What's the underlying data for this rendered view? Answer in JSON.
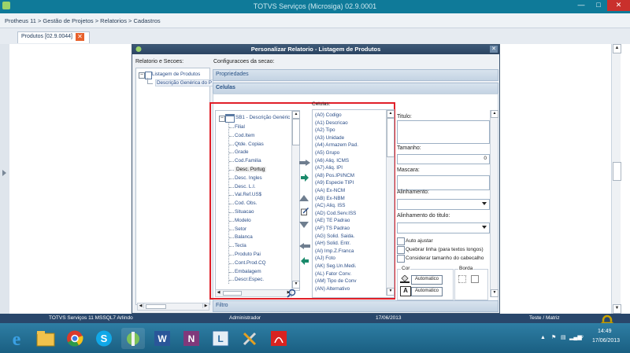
{
  "window": {
    "title": "TOTVS Serviços (Microsiga) 02.9.0001"
  },
  "breadcrumb": "Protheus 11 > Gestão de Projetos > Relatorios > Cadastros",
  "tab": {
    "label": "Produtos [02.9.0044]"
  },
  "dialog": {
    "title": "Personalizar Relatorio - Listagem de Produtos",
    "sections_label": "Relatorio e Secoes:",
    "config_label": "Configuracoes da secao:",
    "tree": {
      "root": "Listagem de Produtos",
      "child": "Descrição Genérica do P"
    },
    "propriedades": "Propriedades",
    "celulas": "Celulas",
    "celulas_sub": "Celulas:",
    "filtro": "Filtro",
    "field_tree_root": "SB1 - Descrição Genéric",
    "fields": [
      "Filial",
      "Cod.Item",
      "Qtde. Copias",
      "Grade",
      "Cod.Familia",
      "Desc. Portug",
      "Desc. Ingles",
      "Desc. L.I.",
      "Val.Ref.US$",
      "Cod. Obs.",
      "Situacao",
      "Modelo",
      "Setor",
      "Balanca",
      "Tecla",
      "Produto Pai",
      "Cont.Prod.CQ",
      "Embalagem",
      "Descr.Espec."
    ],
    "selected_field": "Desc. Portug",
    "cells": [
      "(A0) Codigo",
      "(A1) Descricao",
      "(A2) Tipo",
      "(A3) Unidade",
      "(A4) Armazem Pad.",
      "(A5) Grupo",
      "(A6) Aliq. ICMS",
      "(A7) Aliq. IPI",
      "(A8) Pos.IPI/NCM",
      "(A9) Especie TIPI",
      "(AA) Ex-NCM",
      "(AB) Ex-NBM",
      "(AC) Aliq. ISS",
      "(AD) Cod.Serv.ISS",
      "(AE) TE Padrao",
      "(AF) TS Padrao",
      "(AG) Solid. Saida.",
      "(AH) Solid. Entr.",
      "(AI) Imp.Z.Franca",
      "(AJ) Foto",
      "(AK) Seg.Un.Medi.",
      "(AL) Fator Conv.",
      "(AM) Tipo de Conv",
      "(AN) Alternativo"
    ],
    "props": {
      "titulo": "Titulo:",
      "tamanho": "Tamanho:",
      "tamanho_value": "0",
      "mascara": "Mascara:",
      "alinhamento": "Alinhamento:",
      "alinhamento_titulo": "Alinhamento do titulo:",
      "auto_ajustar": "Auto ajustar",
      "quebrar_linha": "Quebrar linha (para textos longos)",
      "considerar_tamanho": "Considerar tamanho do cabecalho",
      "cor": "Cor",
      "borda": "Borda",
      "automatico1": "Automatico",
      "automatico2": "Automatico"
    }
  },
  "statusbar": {
    "left": "TOTVS Serviços 11 MSSQL7 Arlindo",
    "user": "Administrador",
    "date": "17/06/2013",
    "env": "Teste / Matriz"
  },
  "taskbar": {
    "time": "14:49",
    "date": "17/06/2013"
  },
  "colors": {
    "titlebar": "#0f7a99",
    "highlight": "#e01f28",
    "link": "#2b4e88"
  }
}
